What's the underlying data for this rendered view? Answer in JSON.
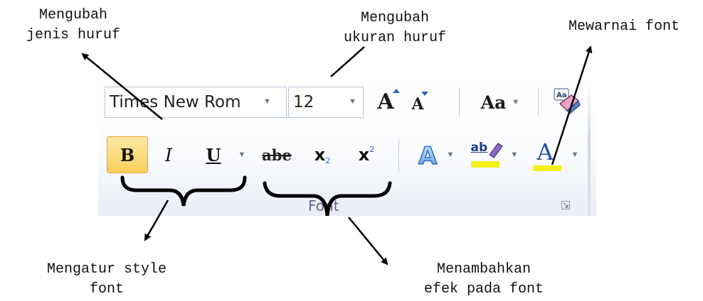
{
  "annotations": {
    "font_type": [
      "Mengubah",
      "jenis huruf"
    ],
    "font_size": [
      "Mengubah",
      "ukuran huruf"
    ],
    "font_color": "Mewarnai font",
    "font_style": [
      "Mengatur style",
      "font"
    ],
    "font_effect": [
      "Menambahkan",
      "efek pada font"
    ]
  },
  "ribbon": {
    "font_name": "Times New Rom",
    "font_size": "12",
    "grow_font_label": "A",
    "shrink_font_label": "A",
    "change_case_label": "Aa",
    "bold_label": "B",
    "italic_label": "I",
    "underline_label": "U",
    "strikethrough_label": "abe",
    "subscript_label": "x",
    "subscript_mark": "2",
    "superscript_label": "x",
    "superscript_mark": "2",
    "text_effects_label": "A",
    "highlight_label": "ab",
    "font_color_label": "A",
    "group_label": "Font",
    "bold_active": true,
    "highlight_color": "#f5f019",
    "font_color_bar": "#f5f019",
    "icons": [
      "clear-formatting-icon",
      "text-effects-icon",
      "highlight-pen-icon",
      "dialog-launcher-icon"
    ]
  }
}
